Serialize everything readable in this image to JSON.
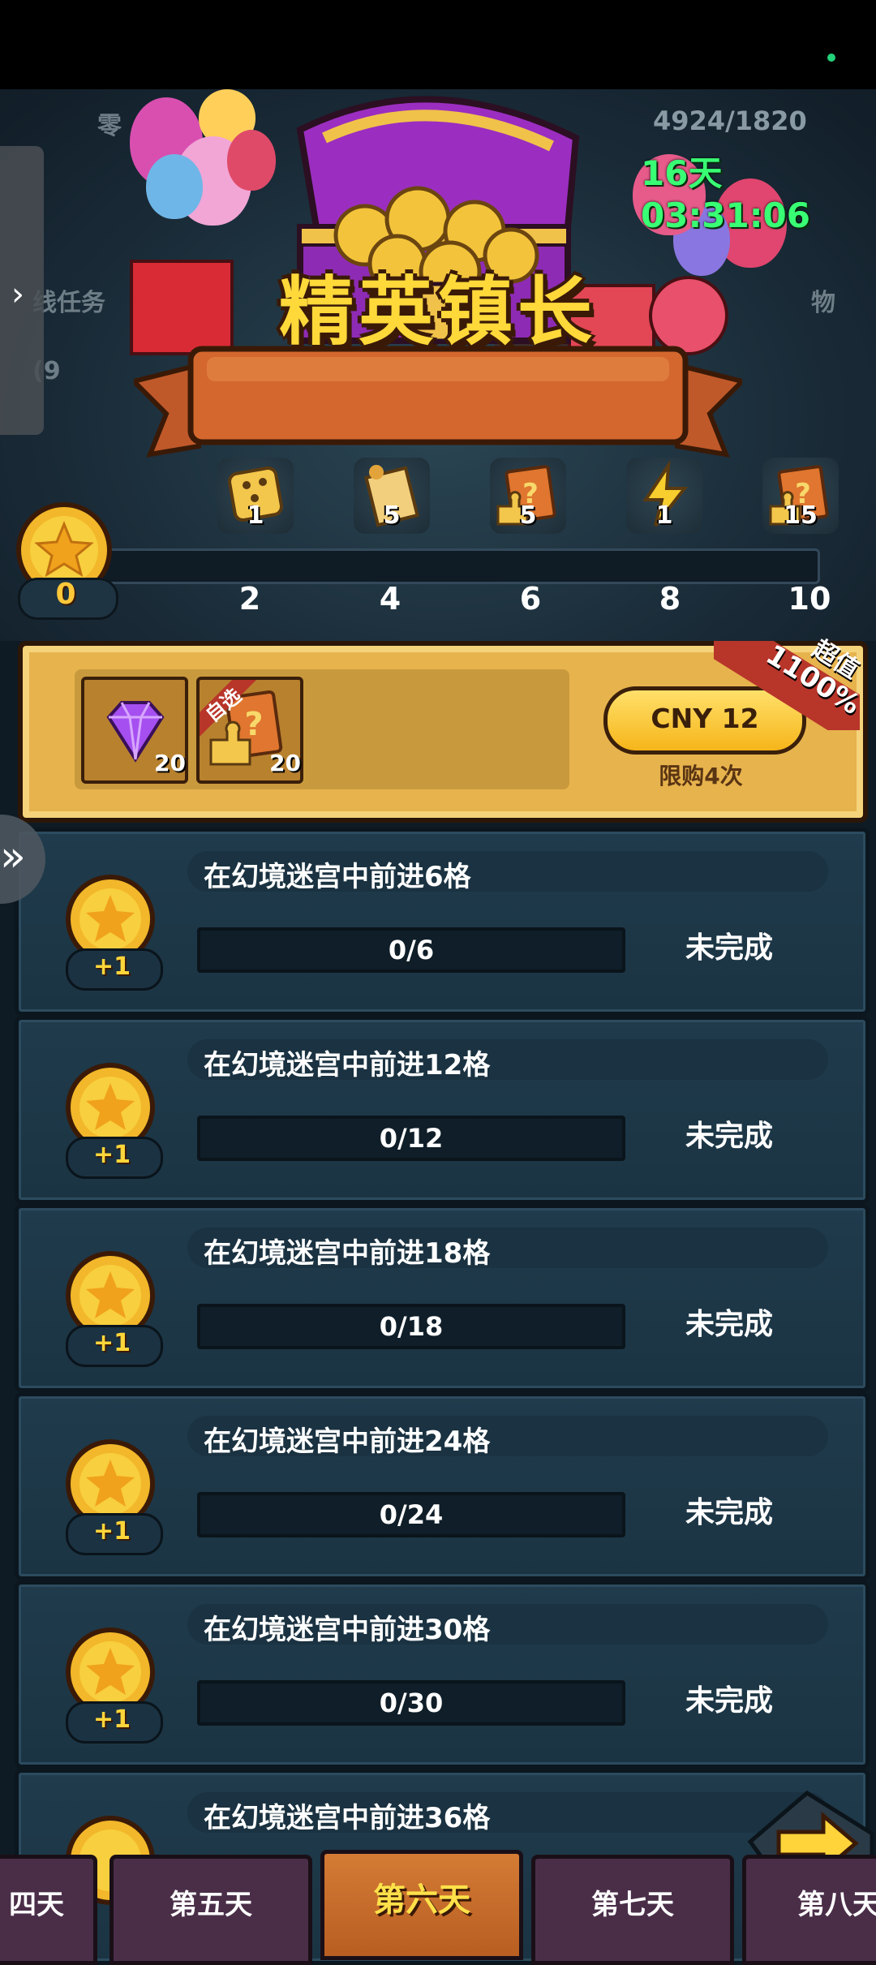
{
  "hero": {
    "energy": "4924/1820",
    "timer": "16天03:31:06",
    "title": "精英镇长",
    "bg_left_text_1": "零",
    "bg_left_text_2": "线任务",
    "bg_left_text_3": "(9",
    "bg_right_text": "物"
  },
  "milestones": {
    "current_coins": "0",
    "items": [
      {
        "threshold": "2",
        "reward_icon": "dice-icon",
        "count": "1"
      },
      {
        "threshold": "4",
        "reward_icon": "scroll-icon",
        "count": "5"
      },
      {
        "threshold": "6",
        "reward_icon": "puzzle-card-icon",
        "count": "5"
      },
      {
        "threshold": "8",
        "reward_icon": "lightning-icon",
        "count": "1"
      },
      {
        "threshold": "10",
        "reward_icon": "puzzle-card-icon",
        "count": "15"
      }
    ],
    "progress": 0
  },
  "offer": {
    "items": [
      {
        "icon": "purple-gem-icon",
        "count": "20"
      },
      {
        "icon": "puzzle-card-icon",
        "count": "20",
        "tag": "自选"
      }
    ],
    "price_label": "CNY 12",
    "limit_label": "限购4次",
    "ribbon_label": "超值",
    "ribbon_percent": "1100%"
  },
  "tasks": [
    {
      "title": "在幻境迷宫中前进6格",
      "progress": "0/6",
      "status": "未完成",
      "reward": "+1"
    },
    {
      "title": "在幻境迷宫中前进12格",
      "progress": "0/12",
      "status": "未完成",
      "reward": "+1"
    },
    {
      "title": "在幻境迷宫中前进18格",
      "progress": "0/18",
      "status": "未完成",
      "reward": "+1"
    },
    {
      "title": "在幻境迷宫中前进24格",
      "progress": "0/24",
      "status": "未完成",
      "reward": "+1"
    },
    {
      "title": "在幻境迷宫中前进30格",
      "progress": "0/30",
      "status": "未完成",
      "reward": "+1"
    },
    {
      "title": "在幻境迷宫中前进36格",
      "progress": "",
      "status": "",
      "reward": ""
    }
  ],
  "day_tabs": [
    {
      "label": "四天",
      "active": false
    },
    {
      "label": "第五天",
      "active": false
    },
    {
      "label": "第六天",
      "active": true
    },
    {
      "label": "第七天",
      "active": false
    },
    {
      "label": "第八天",
      "active": false
    }
  ],
  "colors": {
    "timer": "#39ff74",
    "title": "#ffd93a",
    "active_tab": "#d47b35",
    "gold_panel": "#e7b34d"
  }
}
